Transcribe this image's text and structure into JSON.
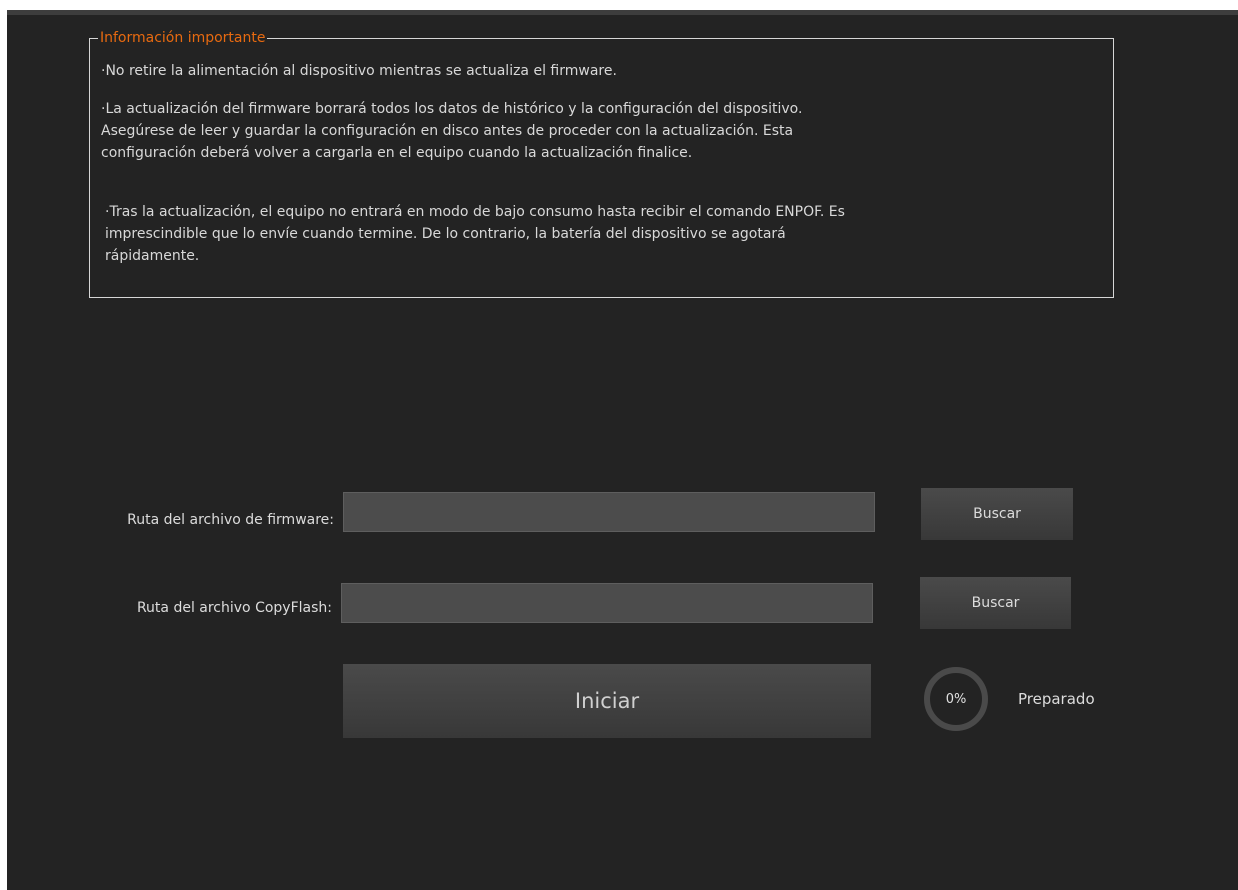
{
  "info_box": {
    "title": "Información importante",
    "line1": "·No retire la alimentación al dispositivo mientras se actualiza el firmware.",
    "para2_line1": "·La actualización del firmware borrará todos los datos de histórico y la configuración del dispositivo.",
    "para2_line2": "Asegúrese de leer y guardar la configuración en disco antes de proceder con la actualización. Esta",
    "para2_line3": "configuración deberá volver a cargarla en el equipo cuando la actualización finalice.",
    "para3_line1": "·Tras la actualización, el equipo no entrará en modo de bajo consumo hasta recibir el comando ENPOF. Es",
    "para3_line2": "imprescindible que lo envíe cuando termine. De lo contrario, la batería del dispositivo se agotará",
    "para3_line3": "rápidamente."
  },
  "firmware": {
    "label": "Ruta del archivo de firmware:",
    "value": "",
    "browse_label": "Buscar"
  },
  "copyflash": {
    "label": "Ruta del archivo CopyFlash:",
    "value": "",
    "browse_label": "Buscar"
  },
  "start_label": "Iniciar",
  "progress": {
    "percent": 0,
    "text": "0%",
    "status": "Preparado"
  },
  "colors": {
    "background": "#232323",
    "accent": "#e86a10",
    "ring": "#4a4a4a"
  }
}
